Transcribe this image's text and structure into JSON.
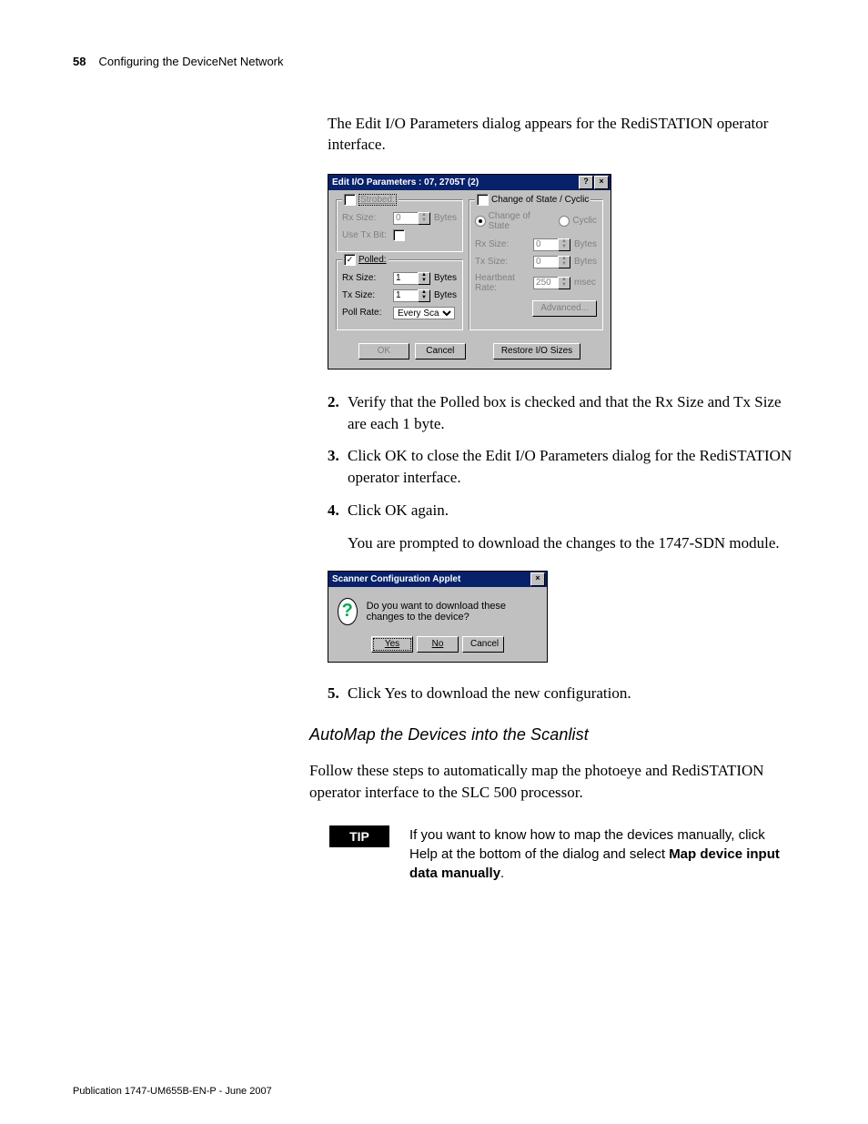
{
  "header": {
    "page_num": "58",
    "chapter": "Configuring the DeviceNet Network"
  },
  "intro": "The Edit I/O Parameters dialog appears for the RediSTATION operator interface.",
  "dialog1": {
    "title": "Edit I/O Parameters : 07, 2705T (2)",
    "strobed": {
      "legend": "Strobed:",
      "rx_label": "Rx Size:",
      "rx_val": "0",
      "bytes": "Bytes",
      "use_tx_label": "Use Tx Bit:"
    },
    "polled": {
      "legend": "Polled:",
      "rx_label": "Rx Size:",
      "rx_val": "1",
      "bytes": "Bytes",
      "tx_label": "Tx Size:",
      "tx_val": "1",
      "poll_label": "Poll Rate:",
      "poll_val": "Every Scan"
    },
    "cos": {
      "legend": "Change of State / Cyclic",
      "opt1": "Change of State",
      "opt2": "Cyclic",
      "rx_label": "Rx Size:",
      "rx_val": "0",
      "bytes": "Bytes",
      "tx_label": "Tx Size:",
      "tx_val": "0",
      "hb_label": "Heartbeat Rate:",
      "hb_val": "250",
      "msec": "msec",
      "adv": "Advanced..."
    },
    "buttons": {
      "ok": "OK",
      "cancel": "Cancel",
      "restore": "Restore I/O Sizes"
    }
  },
  "steps": {
    "s2": "Verify that the Polled box is checked and that the Rx Size and Tx Size are each 1 byte.",
    "s3": "Click OK to close the Edit I/O Parameters dialog for the RediSTATION operator interface.",
    "s4": "Click OK again.",
    "s4after": "You are prompted to download the changes to the 1747-SDN module.",
    "s5": "Click Yes to download the new configuration."
  },
  "dialog2": {
    "title": "Scanner Configuration Applet",
    "msg": "Do you want to download these changes to the device?",
    "yes": "Yes",
    "no": "No",
    "cancel": "Cancel"
  },
  "subheading": "AutoMap the Devices into the Scanlist",
  "followpara": "Follow these steps to automatically map the photoeye and RediSTATION operator interface to the SLC 500 processor.",
  "tip": {
    "label": "TIP",
    "text1": "If you want to know how to map the devices manually, click Help at the bottom of the dialog and select ",
    "bold": "Map device input data manually",
    "period": "."
  },
  "footer": "Publication 1747-UM655B-EN-P - June 2007"
}
